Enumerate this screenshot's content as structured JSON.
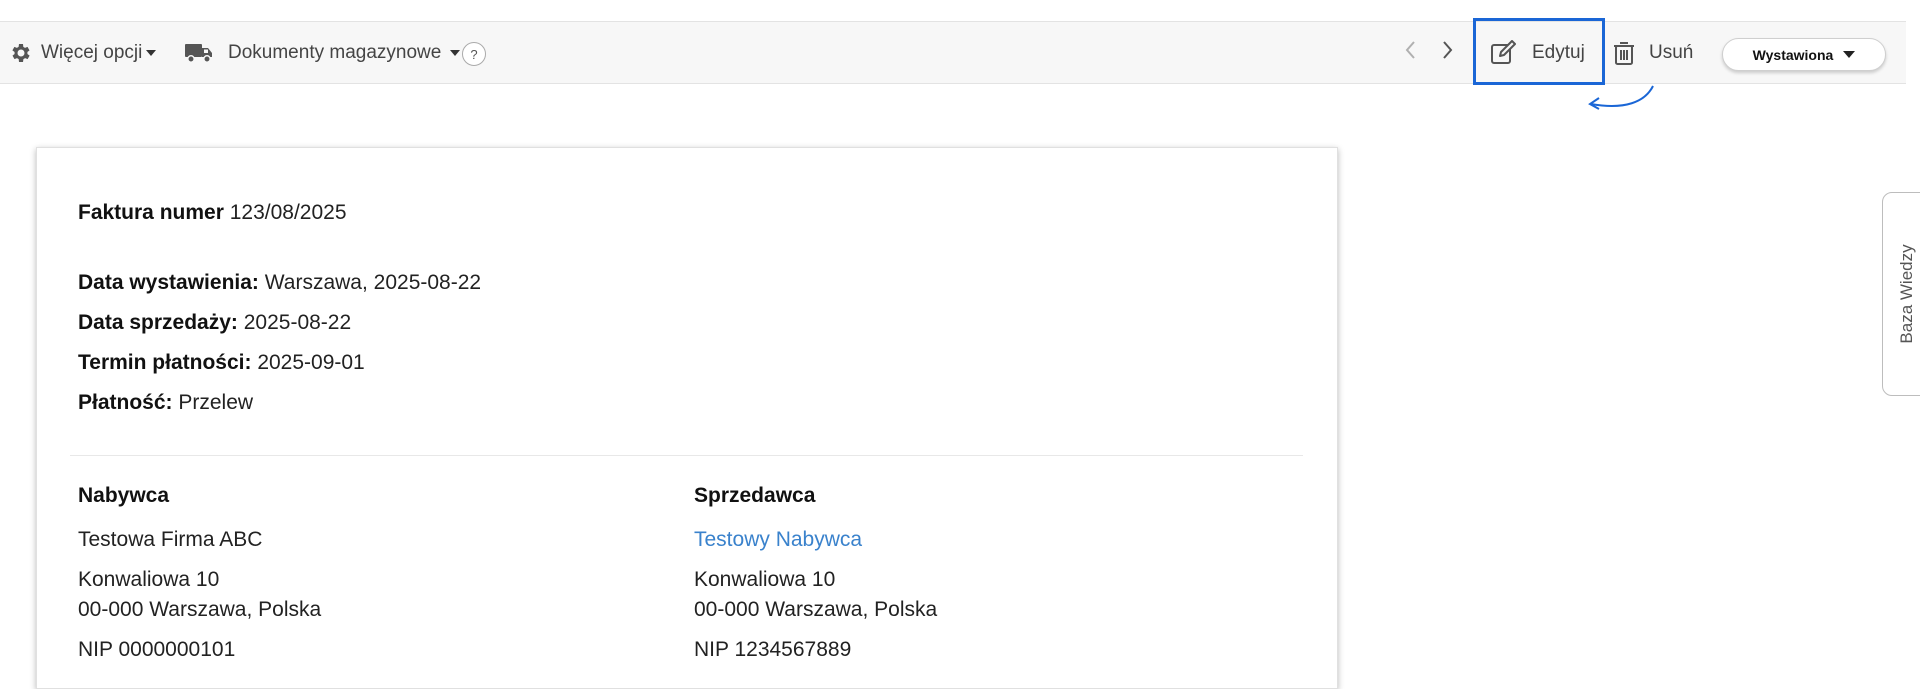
{
  "toolbar": {
    "more_options_label": "Więcej opcji",
    "warehouse_docs_label": "Dokumenty magazynowe",
    "help_label": "?",
    "edit_label": "Edytuj",
    "delete_label": "Usuń",
    "status_label": "Wystawiona"
  },
  "invoice": {
    "number_label": "Faktura numer",
    "number_value": "123/08/2025",
    "issue_label": "Data wystawienia:",
    "issue_value": "Warszawa, 2025-08-22",
    "sale_label": "Data sprzedaży:",
    "sale_value": "2025-08-22",
    "due_label": "Termin płatności:",
    "due_value": "2025-09-01",
    "payment_label": "Płatność:",
    "payment_value": "Przelew"
  },
  "buyer": {
    "title": "Nabywca",
    "name": "Testowa Firma ABC",
    "street": "Konwaliowa 10",
    "city": "00-000 Warszawa, Polska",
    "nip": "NIP 0000000101"
  },
  "seller": {
    "title": "Sprzedawca",
    "name": "Testowy Nabywca",
    "street": "Konwaliowa 10",
    "city": "00-000 Warszawa, Polska",
    "nip": "NIP 1234567889"
  },
  "side_tab": {
    "label": "Baza Wiedzy"
  },
  "colors": {
    "highlight": "#1a66d6",
    "link": "#3a82cc",
    "toolbar_bg": "#f7f7f7"
  }
}
